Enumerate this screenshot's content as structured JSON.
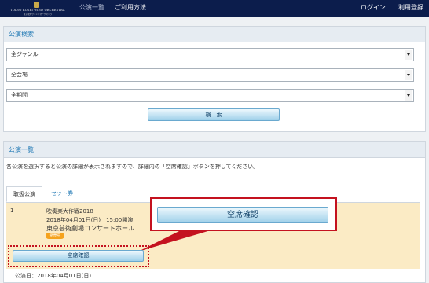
{
  "brand": {
    "name": "Tokyo Kosei Wind Orchestra",
    "name_display": "TOKYO KOSEI WIND ORCHESTRA",
    "subname": "東京佼成ウインドオーケストラ"
  },
  "nav": {
    "performances": "公演一覧",
    "guide": "ご利用方法",
    "login": "ログイン",
    "register": "利用登録"
  },
  "search": {
    "title": "公演検索",
    "genre_selected": "全ジャンル",
    "venue_selected": "全会場",
    "period_selected": "全期間",
    "button_label": "検　索"
  },
  "list": {
    "title": "公演一覧",
    "instruction": "各公演を選択すると公演の詳細が表示されますので、詳細内の「空席確認」ボタンを押してください。",
    "tabs": [
      "取扱公演",
      "セット券"
    ],
    "active_tab": "取扱公演"
  },
  "performance": {
    "number": "1",
    "title": "吹奏楽大作戦2018",
    "datetime": "2018年04月01日(日)　15:00開演",
    "venue": "東京芸術劇場コンサートホール",
    "status_badge": "発売中",
    "seat_button_label": "空席確認",
    "detail_date": "公演日：2018年04月01日(日)"
  },
  "callout": {
    "seat_button_label": "空席確認"
  },
  "colors": {
    "topbar": "#0c1d4c",
    "accent_link": "#1f78b4",
    "highlight_bg": "#fbebc5",
    "badge": "#f5a21c",
    "callout_red": "#c4121f"
  }
}
